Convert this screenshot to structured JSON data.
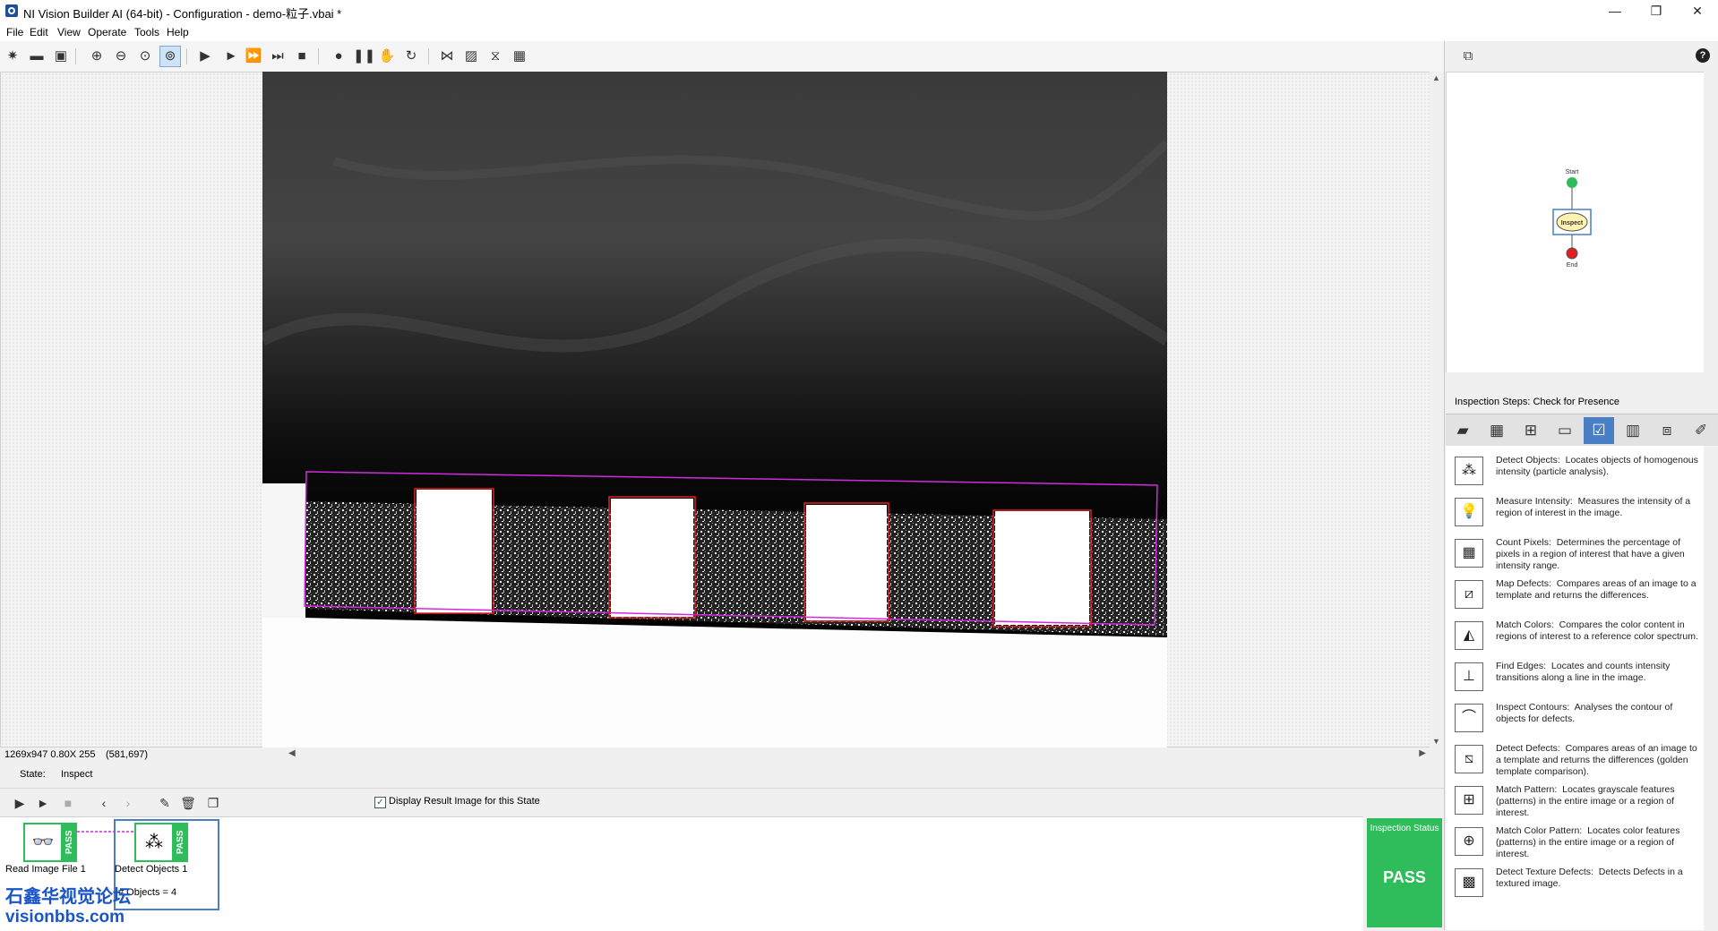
{
  "window": {
    "title": "NI Vision Builder AI (64-bit) - Configuration - demo-粒子.vbai *",
    "minimize": "—",
    "restore": "❐",
    "close": "✕"
  },
  "menu": [
    "File",
    "Edit",
    "View",
    "Operate",
    "Tools",
    "Help"
  ],
  "toolbar": {
    "icons": [
      "new-icon",
      "open-icon",
      "save-icon",
      "zoom-in-icon",
      "zoom-out-icon",
      "zoom-fit-icon",
      "zoom-to-fit-active-icon",
      "step-run-icon",
      "run-icon",
      "run-continuous-icon",
      "step-skip-icon",
      "stop-icon",
      "lightbulb-icon",
      "pause-icon",
      "hand-icon",
      "refresh-icon",
      "image-mode-icon",
      "image-icon",
      "image-compare-icon",
      "layout-icon"
    ],
    "help": "?"
  },
  "viewer": {
    "status_dims": "1269x947 0.80X 255",
    "status_coord": "(581,697)"
  },
  "state": {
    "label": "State:",
    "value": "Inspect",
    "display_result_label": "Display Result Image for this State",
    "display_result_checked": true
  },
  "steps": [
    {
      "name": "Read Image File 1",
      "status": "PASS",
      "icon": "read-image-icon"
    },
    {
      "name": "Detect Objects 1",
      "status": "PASS",
      "icon": "detect-objects-icon",
      "result": "# Objects = 4"
    }
  ],
  "inspection_status": {
    "label": "Inspection Status",
    "value": "PASS"
  },
  "flowchart": {
    "start": "Start",
    "inspect": "Inspect",
    "end": "End"
  },
  "inspection_steps": {
    "header": "Inspection Steps: Check for Presence",
    "items": [
      {
        "title": "Detect Objects:",
        "desc": "Locates objects of homogenous intensity (particle analysis).",
        "icon": "detect-objects-icon"
      },
      {
        "title": "Measure Intensity:",
        "desc": "Measures the intensity of a region of interest in the image.",
        "icon": "measure-intensity-icon"
      },
      {
        "title": "Count Pixels:",
        "desc": "Determines the percentage of pixels in a region of interest that have a given intensity range.",
        "icon": "count-pixels-icon"
      },
      {
        "title": "Map Defects:",
        "desc": "Compares areas of an image to a template and returns the differences.",
        "icon": "map-defects-icon"
      },
      {
        "title": "Match Colors:",
        "desc": "Compares the color content in regions of interest to a reference color spectrum.",
        "icon": "match-colors-icon"
      },
      {
        "title": "Find Edges:",
        "desc": "Locates and counts intensity transitions along a line in the image.",
        "icon": "find-edges-icon"
      },
      {
        "title": "Inspect Contours:",
        "desc": "Analyses the contour of objects for defects.",
        "icon": "inspect-contours-icon"
      },
      {
        "title": "Detect Defects:",
        "desc": "Compares areas of an image to a template and returns the differences (golden template comparison).",
        "icon": "detect-defects-icon"
      },
      {
        "title": "Match Pattern:",
        "desc": "Locates grayscale features (patterns) in the entire image or a region of interest.",
        "icon": "match-pattern-icon"
      },
      {
        "title": "Match Color Pattern:",
        "desc": "Locates color features (patterns) in the entire image or a region of interest.",
        "icon": "match-color-pattern-icon"
      },
      {
        "title": "Detect Texture Defects:",
        "desc": "Detects Defects in a textured image.",
        "icon": "texture-defects-icon"
      }
    ]
  },
  "watermark": {
    "line1": "石鑫华视觉论坛",
    "line2": "visionbbs.com"
  },
  "colors": {
    "pass_green": "#2ebd5a",
    "selection_blue": "#4a7fc6",
    "roi_magenta": "#d02adf",
    "object_red": "#e02020"
  }
}
